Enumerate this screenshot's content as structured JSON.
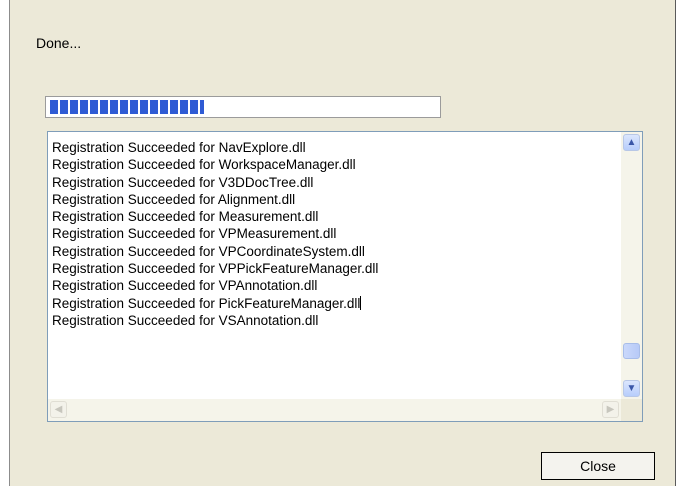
{
  "status_text": "Done...",
  "progress": {
    "value": 0.39
  },
  "log": {
    "lines": [
      "Registration Succeeded for NavExplore.dll",
      "Registration Succeeded for WorkspaceManager.dll",
      "Registration Succeeded for V3DDocTree.dll",
      "Registration Succeeded for Alignment.dll",
      "Registration Succeeded for Measurement.dll",
      "Registration Succeeded for VPMeasurement.dll",
      "Registration Succeeded for VPCoordinateSystem.dll",
      "Registration Succeeded for VPPickFeatureManager.dll",
      "Registration Succeeded for VPAnnotation.dll",
      "Registration Succeeded for PickFeatureManager.dll",
      "Registration Succeeded for VSAnnotation.dll"
    ]
  },
  "close_label": "Close",
  "colors": {
    "progress_fill": "#2f5bd4",
    "dialog_bg": "#ece9d8",
    "scroll_button": "#b7cdfb"
  }
}
